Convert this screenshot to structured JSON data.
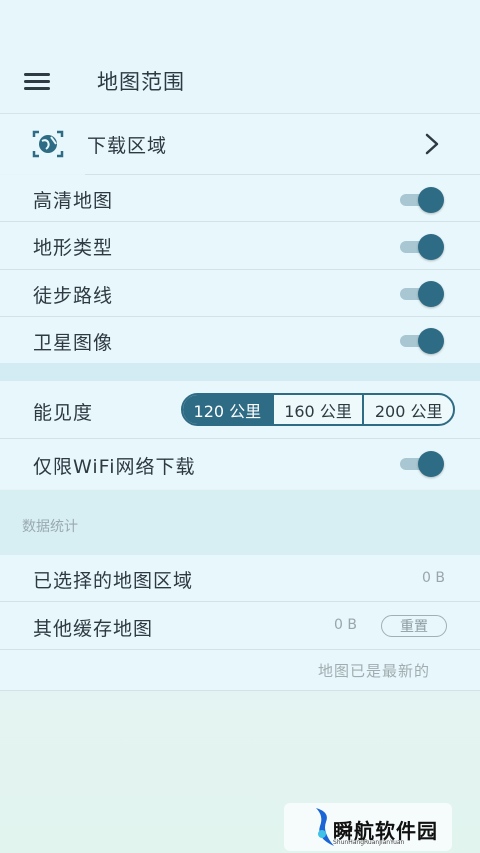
{
  "header": {
    "title": "地图范围",
    "menu_icon": "hamburger-menu-icon"
  },
  "download_region": {
    "label": "下载区域",
    "icon": "globe-target-icon",
    "chevron_icon": "chevron-right-icon"
  },
  "toggles": [
    {
      "label": "高清地图",
      "on": true
    },
    {
      "label": "地形类型",
      "on": true
    },
    {
      "label": "徒步路线",
      "on": true
    },
    {
      "label": "卫星图像",
      "on": true
    }
  ],
  "visibility": {
    "label": "能见度",
    "options": [
      "120 公里",
      "160 公里",
      "200 公里"
    ],
    "selected": "120 公里"
  },
  "wifi_only": {
    "label": "仅限WiFi网络下载",
    "on": true
  },
  "stats": {
    "section_title": "数据统计",
    "selected_maps": {
      "label": "已选择的地图区域",
      "value": "0 B"
    },
    "other_cache": {
      "label": "其他缓存地图",
      "value": "0 B",
      "reset_label": "重置"
    },
    "status": "地图已是最新的"
  },
  "watermark": {
    "title": "瞬航软件园",
    "subtitle": "ShunHangRuanJianYuan"
  },
  "colors": {
    "accent": "#2e6b84",
    "track": "#a8c7d2",
    "background": "#e8f7fb"
  }
}
